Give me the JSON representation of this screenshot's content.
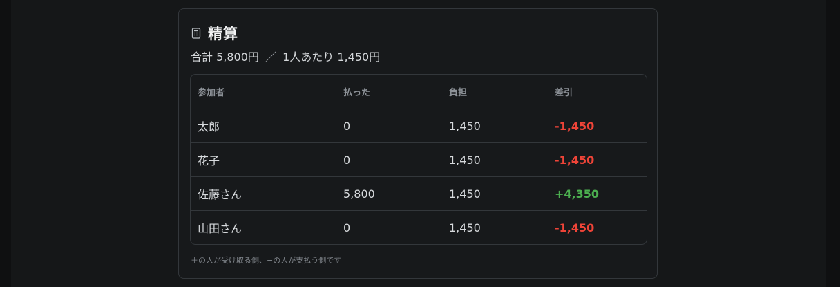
{
  "card": {
    "icon": "receipt-icon",
    "title": "精算",
    "summary_total": "合計 5,800円",
    "summary_separator": "／",
    "summary_per_person": "1人あたり 1,450円"
  },
  "table": {
    "headers": [
      "参加者",
      "払った",
      "負担",
      "差引"
    ],
    "rows": [
      {
        "name": "太郎",
        "paid": "0",
        "share": "1,450",
        "balance": "-1,450",
        "sign": "negative"
      },
      {
        "name": "花子",
        "paid": "0",
        "share": "1,450",
        "balance": "-1,450",
        "sign": "negative"
      },
      {
        "name": "佐藤さん",
        "paid": "5,800",
        "share": "1,450",
        "balance": "+4,350",
        "sign": "positive"
      },
      {
        "name": "山田さん",
        "paid": "0",
        "share": "1,450",
        "balance": "-1,450",
        "sign": "negative"
      }
    ]
  },
  "footnote": "＋の人が受け取る側、−の人が支払う側です",
  "colors": {
    "background": "#151718",
    "card": "#17191b",
    "border": "#33373b",
    "negative": "#ef4438",
    "positive": "#4caf50"
  }
}
